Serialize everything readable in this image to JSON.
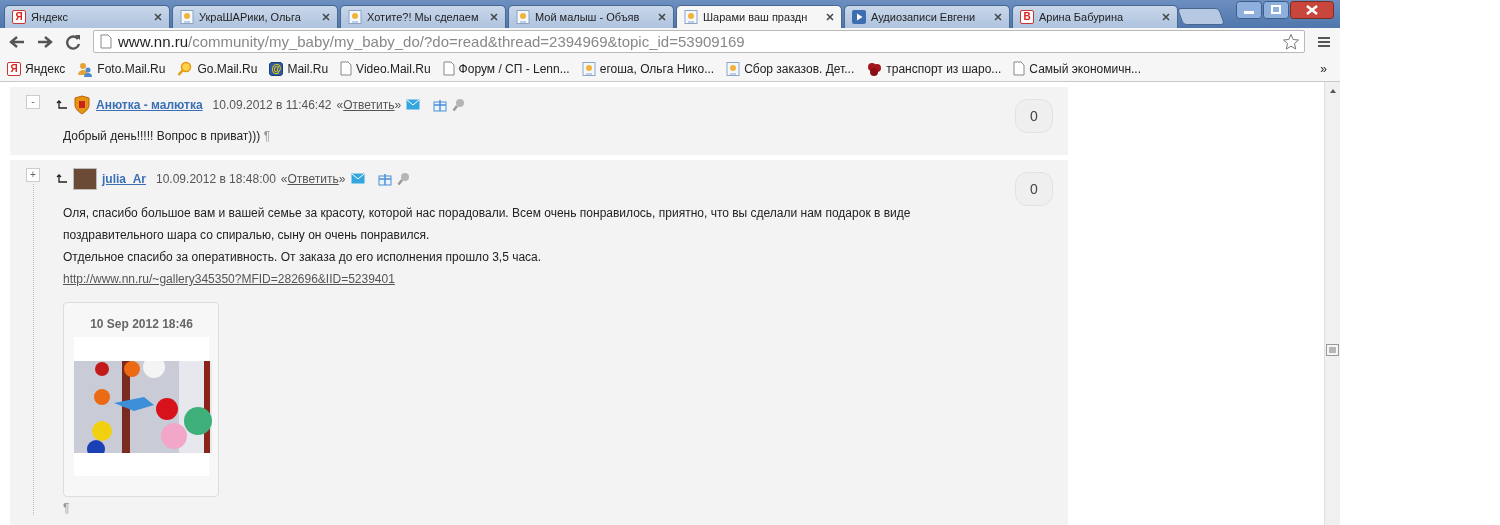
{
  "tabs": [
    {
      "title": "Яндекс",
      "kind": "letter",
      "letter": "Я",
      "selected": false
    },
    {
      "title": "УкраШАРики, Ольга",
      "kind": "site",
      "selected": false
    },
    {
      "title": "Хотите?! Мы сделаем",
      "kind": "site",
      "selected": false
    },
    {
      "title": "Мой малыш - Объяв",
      "kind": "site",
      "selected": false
    },
    {
      "title": "Шарами ваш праздн",
      "kind": "site",
      "selected": true
    },
    {
      "title": "Аудиозаписи Евгени",
      "kind": "play",
      "selected": false
    },
    {
      "title": "Арина Бабурина",
      "kind": "letter",
      "letter": "В",
      "selected": false
    }
  ],
  "address_bar": {
    "host": "www.nn.ru",
    "path": "/community/my_baby/my_baby_do/?do=read&thread=2394969&topic_id=53909169"
  },
  "bookmarks": {
    "items": [
      {
        "label": "Яндекс",
        "kind": "letter",
        "letter": "Я"
      },
      {
        "label": "Foto.Mail.Ru",
        "kind": "people"
      },
      {
        "label": "Go.Mail.Ru",
        "kind": "search"
      },
      {
        "label": "Mail.Ru",
        "kind": "letter",
        "letter": "@"
      },
      {
        "label": "Video.Mail.Ru",
        "kind": "page"
      },
      {
        "label": "Форум / СП - Lenn...",
        "kind": "page"
      },
      {
        "label": "егоша, Ольга Нико...",
        "kind": "site"
      },
      {
        "label": "Сбор заказов. Дет...",
        "kind": "site"
      },
      {
        "label": "транспорт из шаро...",
        "kind": "red"
      },
      {
        "label": "Самый экономичн...",
        "kind": "page"
      }
    ],
    "overflow": "»"
  },
  "comments": [
    {
      "toggle": "-",
      "kind": "shield",
      "author": "Анютка - малютка",
      "date": "10.09.2012 в 11:46:42",
      "reply_open": "«",
      "reply": "Ответить",
      "reply_close": "»",
      "score": "0",
      "paragraphs": [
        "Добрый день!!!!! Вопрос в приват)))"
      ],
      "pilcrow": "¶"
    },
    {
      "toggle": "+",
      "kind": "photo",
      "author": "julia_Ar",
      "date": "10.09.2012 в 18:48:00",
      "reply_open": "«",
      "reply": "Ответить",
      "reply_close": "»",
      "score": "0",
      "paragraphs": [
        "Оля, спасибо большое вам и вашей семье за красоту, которой нас порадовали. Всем очень понравилось, приятно, что вы сделали нам подарок в виде поздравительного шара со спиралью, сыну он очень понравился.",
        "Отдельное спасибо за оперативность. От заказа до его исполнения прошло 3,5 часа."
      ],
      "link": "http://www.nn.ru/~gallery345350?MFID=282696&IID=5239401",
      "photo": {
        "caption": "10 Sep 2012 18:46"
      },
      "pilcrow": "¶"
    }
  ]
}
